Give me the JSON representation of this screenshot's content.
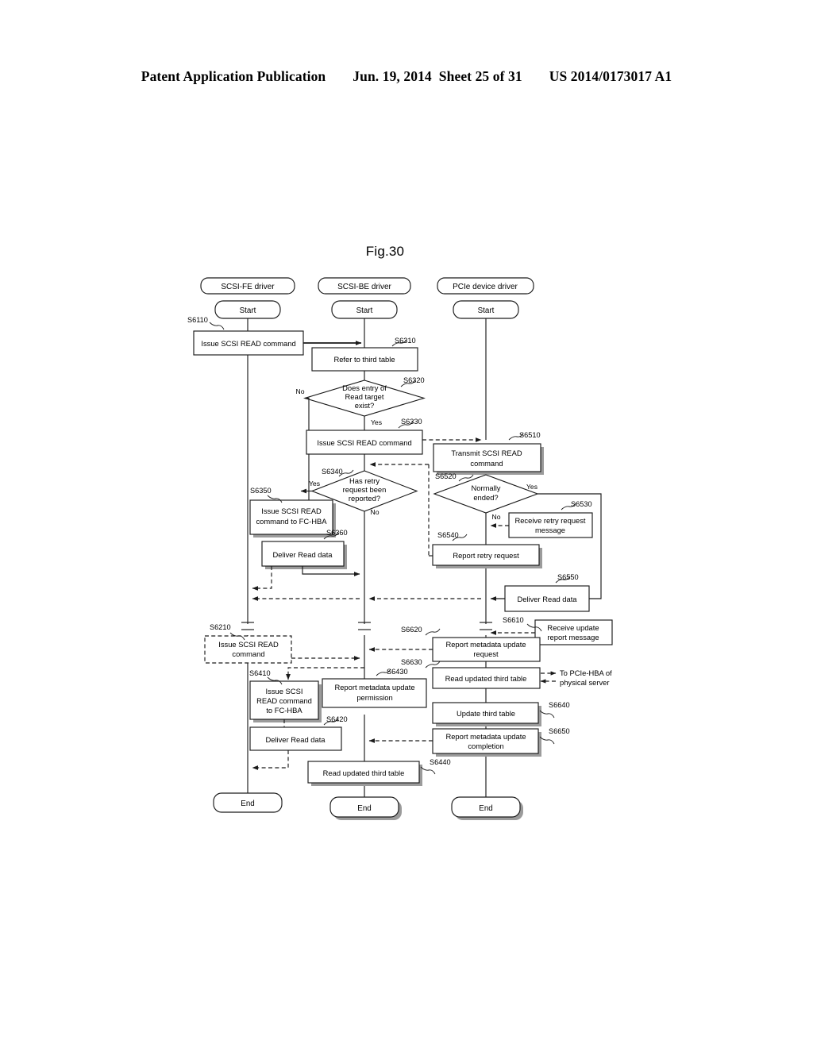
{
  "header": {
    "publication": "Patent Application Publication",
    "date": "Jun. 19, 2014",
    "sheet": "Sheet 25 of 31",
    "document_number": "US 2014/0173017 A1"
  },
  "figure": {
    "title": "Fig.30",
    "lanes": [
      {
        "id": "fe",
        "label": "SCSI-FE driver"
      },
      {
        "id": "be",
        "label": "SCSI-BE driver"
      },
      {
        "id": "pcie",
        "label": "PCIe device driver"
      }
    ],
    "terminals": {
      "start": "Start",
      "end": "End"
    },
    "nodes": [
      {
        "id": "n6110",
        "step": "S6110",
        "lane": "fe",
        "shape": "process",
        "text": "Issue SCSI READ command"
      },
      {
        "id": "n6310",
        "step": "S6310",
        "lane": "be",
        "shape": "process",
        "text": "Refer to third table"
      },
      {
        "id": "n6320",
        "step": "S6320",
        "lane": "be",
        "shape": "decision",
        "text": "Does entry of Read target exist?"
      },
      {
        "id": "n6330",
        "step": "S6330",
        "lane": "be",
        "shape": "process",
        "text": "Issue SCSI READ command"
      },
      {
        "id": "n6340",
        "step": "S6340",
        "lane": "be",
        "shape": "decision",
        "text": "Has retry request been reported?"
      },
      {
        "id": "n6350",
        "step": "S6350",
        "lane": "fe",
        "shape": "process",
        "text": "Issue SCSI READ command to FC-HBA"
      },
      {
        "id": "n6360",
        "step": "S6360",
        "lane": "fe",
        "shape": "process",
        "text": "Deliver Read data"
      },
      {
        "id": "n6510",
        "step": "S6510",
        "lane": "pcie",
        "shape": "process",
        "text": "Transmit SCSI READ command"
      },
      {
        "id": "n6520",
        "step": "S6520",
        "lane": "pcie",
        "shape": "decision",
        "text": "Normally ended?"
      },
      {
        "id": "n6530",
        "step": "S6530",
        "lane": "pcie",
        "shape": "process",
        "text": "Receive retry request message"
      },
      {
        "id": "n6540",
        "step": "S6540",
        "lane": "pcie",
        "shape": "process",
        "text": "Report retry request"
      },
      {
        "id": "n6550",
        "step": "S6550",
        "lane": "pcie",
        "shape": "process",
        "text": "Deliver Read data"
      },
      {
        "id": "n6610",
        "step": "S6610",
        "lane": "pcie",
        "shape": "process",
        "text": "Receive update report message"
      },
      {
        "id": "n6620",
        "step": "S6620",
        "lane": "pcie",
        "shape": "process",
        "text": "Report metadata update request"
      },
      {
        "id": "n6630",
        "step": "S6630",
        "lane": "pcie",
        "shape": "process",
        "text": "Read updated third table"
      },
      {
        "id": "n6640",
        "step": "S6640",
        "lane": "pcie",
        "shape": "process",
        "text": "Update third table"
      },
      {
        "id": "n6650",
        "step": "S6650",
        "lane": "pcie",
        "shape": "process",
        "text": "Report metadata update completion"
      },
      {
        "id": "n6210",
        "step": "S6210",
        "lane": "fe",
        "shape": "process-dashed",
        "text": "Issue SCSI READ command"
      },
      {
        "id": "n6410",
        "step": "S6410",
        "lane": "fe",
        "shape": "process",
        "text": "Issue SCSI READ command to FC-HBA"
      },
      {
        "id": "n6420",
        "step": "S6420",
        "lane": "fe",
        "shape": "process",
        "text": "Deliver Read data"
      },
      {
        "id": "n6430",
        "step": "S6430",
        "lane": "be",
        "shape": "process",
        "text": "Report metadata update permission"
      },
      {
        "id": "n6440",
        "step": "S6440",
        "lane": "be",
        "shape": "process",
        "text": "Read updated third table"
      }
    ],
    "branch_labels": {
      "n6320_no": "No",
      "n6320_yes": "Yes",
      "n6340_yes": "Yes",
      "n6340_no": "No",
      "n6520_yes": "Yes",
      "n6520_no": "No"
    },
    "annotations": [
      {
        "id": "ann-pcie-hba",
        "text": "To PCIe-HBA of physical server"
      }
    ],
    "node_text_lines": {
      "n6110": [
        "Issue SCSI READ command"
      ],
      "n6310": [
        "Refer to third table"
      ],
      "n6320": [
        "Does entry of",
        "Read target",
        "exist?"
      ],
      "n6330": [
        "Issue SCSI READ command"
      ],
      "n6340": [
        "Has retry",
        "request been",
        "reported?"
      ],
      "n6350": [
        "Issue SCSI READ",
        "command to FC-HBA"
      ],
      "n6360": [
        "Deliver Read data"
      ],
      "n6510": [
        "Transmit SCSI READ",
        "command"
      ],
      "n6520": [
        "Normally",
        "ended?"
      ],
      "n6530": [
        "Receive retry request",
        "message"
      ],
      "n6540": [
        "Report retry request"
      ],
      "n6550": [
        "Deliver Read data"
      ],
      "n6610": [
        "Receive update",
        "report message"
      ],
      "n6620": [
        "Report metadata update",
        "request"
      ],
      "n6630": [
        "Read updated third table"
      ],
      "n6640": [
        "Update third table"
      ],
      "n6650": [
        "Report metadata update",
        "completion"
      ],
      "n6210": [
        "Issue SCSI READ",
        "command"
      ],
      "n6410": [
        "Issue SCSI",
        "READ command",
        "to FC-HBA"
      ],
      "n6420": [
        "Deliver Read data"
      ],
      "n6430": [
        "Report metadata  update",
        "permission"
      ],
      "n6440": [
        "Read updated third table"
      ],
      "ann-pcie-hba": [
        "To PCIe-HBA of",
        "physical server"
      ]
    },
    "colors": {
      "ink": "#1a1a1a",
      "paper": "#ffffff",
      "shadow": "#9b9b9b"
    }
  }
}
